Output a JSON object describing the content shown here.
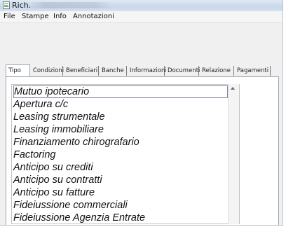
{
  "window": {
    "title": "Rich."
  },
  "menu": [
    "File",
    "Stampe",
    "Info",
    "Annotazioni"
  ],
  "tabs": [
    {
      "label": "Tipo",
      "active": true
    },
    {
      "label": "Condizioni",
      "active": false
    },
    {
      "label": "Beneficiari",
      "active": false
    },
    {
      "label": "Banche",
      "active": false
    },
    {
      "label": "Informazioni",
      "active": false
    },
    {
      "label": "Documenti",
      "active": false
    },
    {
      "label": "Relazione",
      "active": false
    },
    {
      "label": "Pagamenti",
      "active": false
    }
  ],
  "list": {
    "selected_index": 0,
    "items": [
      "Mutuo ipotecario",
      "Apertura c/c",
      "Leasing strumentale",
      "Leasing immobiliare",
      "Finanziamento chirografario",
      "Factoring",
      "Anticipo su crediti",
      "Anticipo su contratti",
      "Anticipo su fatture",
      "Fideiussione commerciali",
      "Fideiussione Agenzia Entrate"
    ]
  },
  "icons": {
    "app": "document-list-icon",
    "scroll_up": "scroll-up-arrow-icon"
  }
}
